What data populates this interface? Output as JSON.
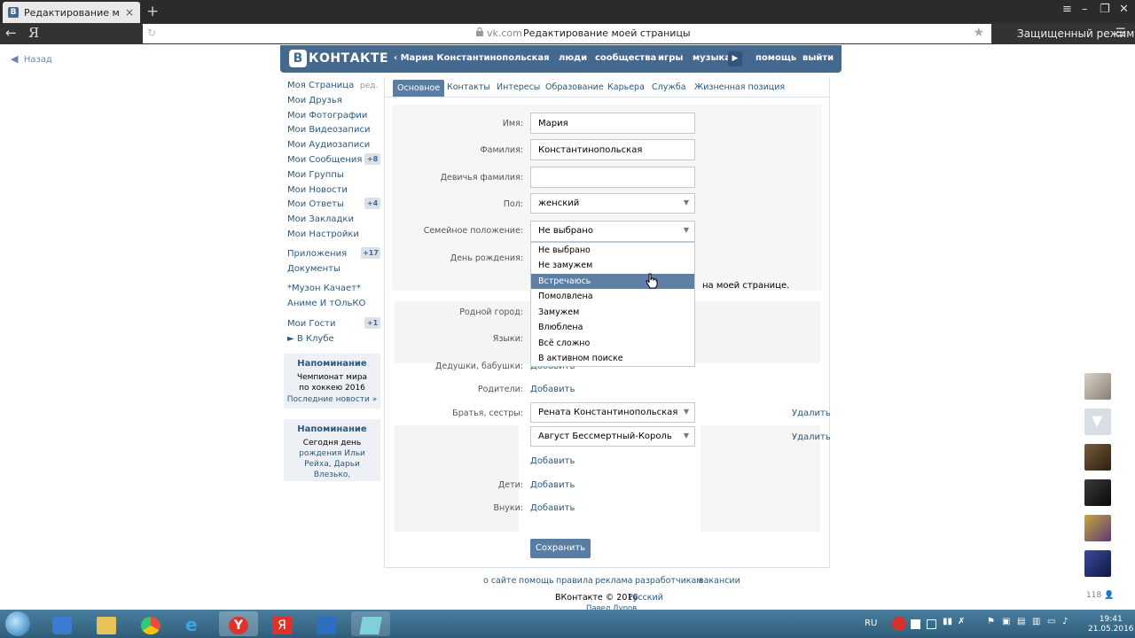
{
  "browser": {
    "tab_title": "Редактирование моей с",
    "tab_favicon": "В",
    "tab_close": "×",
    "new_tab": "+",
    "ya_button": "Я",
    "url_domain": "vk.com",
    "url_title": "Редактирование моей страницы",
    "incognito_label": "Защищенный режим"
  },
  "page": {
    "back_label": "Назад"
  },
  "header": {
    "logo_box": "В",
    "logo_text": "КОНТАКТЕ",
    "user_name": "‹ Мария Константинопольская",
    "nav": [
      "люди",
      "сообщества",
      "игры",
      "музыка",
      "помощь",
      "выйти"
    ]
  },
  "left_menu": {
    "items": [
      {
        "label": "Моя Страница",
        "extra": "ред."
      },
      {
        "label": "Мои Друзья"
      },
      {
        "label": "Мои Фотографии"
      },
      {
        "label": "Мои Видеозаписи"
      },
      {
        "label": "Мои Аудиозаписи"
      },
      {
        "label": "Мои Сообщения",
        "badge": "+8"
      },
      {
        "label": "Мои Группы"
      },
      {
        "label": "Мои Новости"
      },
      {
        "label": "Мои Ответы",
        "badge": "+4"
      },
      {
        "label": "Мои Закладки"
      },
      {
        "label": "Мои Настройки"
      },
      {
        "label": "Приложения",
        "badge": "+17"
      },
      {
        "label": "Документы"
      },
      {
        "label": "*Музон Качает*"
      },
      {
        "label": "Аниме И тОльКО"
      },
      {
        "label": "Мои Гости",
        "badge": "+1"
      },
      {
        "label": "► В Клубе"
      }
    ]
  },
  "reminders": [
    {
      "title": "Напоминание",
      "body1": "Чемпионат мира",
      "body2": "по хоккею 2016",
      "link": "Последние новости »"
    },
    {
      "title": "Напоминание",
      "body1": "Сегодня день",
      "body2": "рождения Ильи",
      "body3": "Рейха, Дарьи",
      "body4": "Влезько,"
    }
  ],
  "profile_tabs": [
    "Основное",
    "Контакты",
    "Интересы",
    "Образование",
    "Карьера",
    "Служба",
    "Жизненная позиция"
  ],
  "form": {
    "first_name_label": "Имя:",
    "first_name_value": "Мария",
    "last_name_label": "Фамилия:",
    "last_name_value": "Константинопольская",
    "maiden_name_label": "Девичья фамилия:",
    "maiden_name_value": "",
    "gender_label": "Пол:",
    "gender_value": "женский",
    "relationship_label": "Семейное положение:",
    "relationship_value": "Не выбрано",
    "birthday_label": "День рождения:",
    "show_on_page_text": "на моей странице.",
    "hometown_label": "Родной город:",
    "languages_label": "Языки:",
    "grandparents_label": "Дедушки, бабушки:",
    "parents_label": "Родители:",
    "siblings_label": "Братья, сестры:",
    "sibling_1": "Рената Константинопольская",
    "sibling_2": "Август Бессмертный-Король",
    "children_label": "Дети:",
    "grandchildren_label": "Внуки:",
    "add_label": "Добавить",
    "remove_label": "Удалить",
    "save_label": "Сохранить"
  },
  "relationship_options": [
    "Не выбрано",
    "Не замужем",
    "Встречаюсь",
    "Помолвлена",
    "Замужем",
    "Влюблена",
    "Всё сложно",
    "В активном поиске"
  ],
  "relationship_highlighted": "Встречаюсь",
  "footer": {
    "links": [
      "о сайте",
      "помощь",
      "правила",
      "реклама",
      "разработчикам",
      "вакансии"
    ],
    "copyright": "ВКонтакте © 2016",
    "language": "Русский",
    "author": "Павел Дуров"
  },
  "sidebar_right": {
    "online_count": "118"
  },
  "taskbar": {
    "language": "RU",
    "time": "19:41",
    "date": "21.05.2016"
  },
  "colors": {
    "vk_blue": "#45688e",
    "vk_link": "#2b587a",
    "highlight": "#5f7fa5"
  }
}
